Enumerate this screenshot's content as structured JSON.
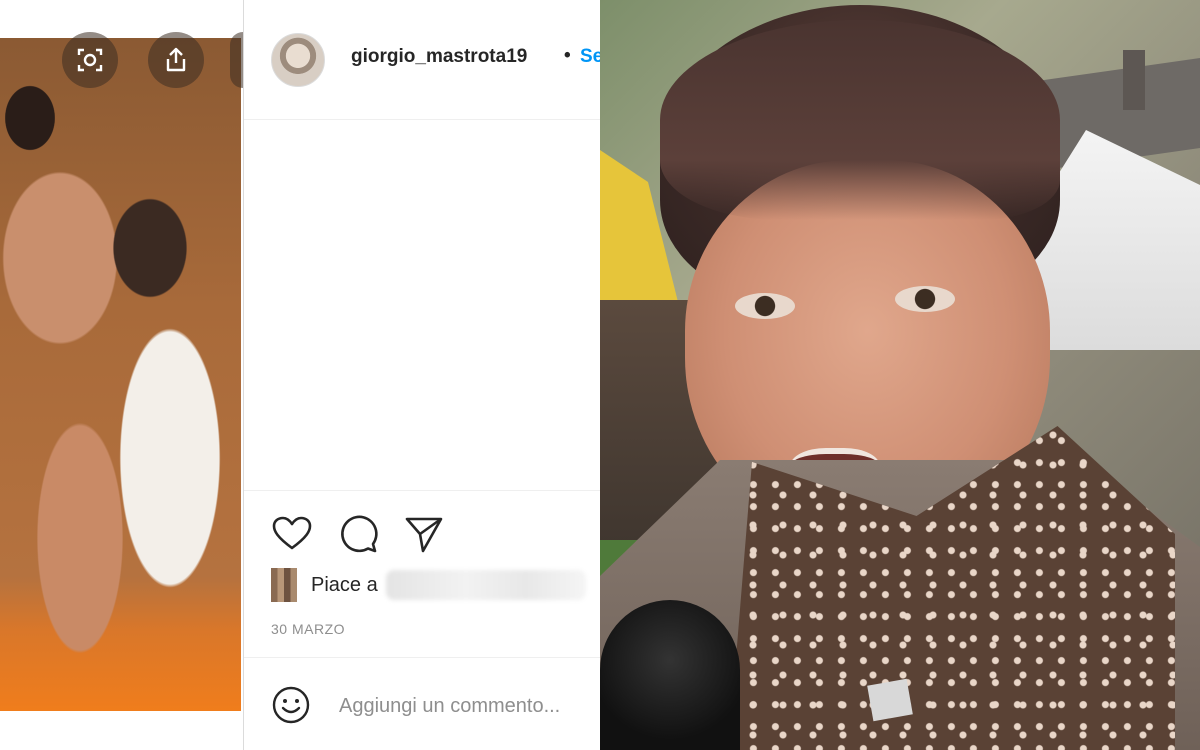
{
  "left_photo": {
    "overlay_icons": [
      {
        "name": "visual-search-icon"
      },
      {
        "name": "share-icon"
      },
      {
        "name": "more-icon"
      }
    ]
  },
  "post": {
    "username": "giorgio_mastrota19",
    "separator": "•",
    "follow_text": "Segui",
    "actions": [
      {
        "name": "heart-icon"
      },
      {
        "name": "comment-icon"
      },
      {
        "name": "share-direct-icon"
      }
    ],
    "likes_label": "Piace a",
    "date": "30 MARZO",
    "comment": {
      "placeholder": "Aggiungi un commento..."
    }
  },
  "colors": {
    "text": "#262626",
    "secondary": "#8e8e8e",
    "link": "#0095f6",
    "border": "#dbdbdb"
  }
}
